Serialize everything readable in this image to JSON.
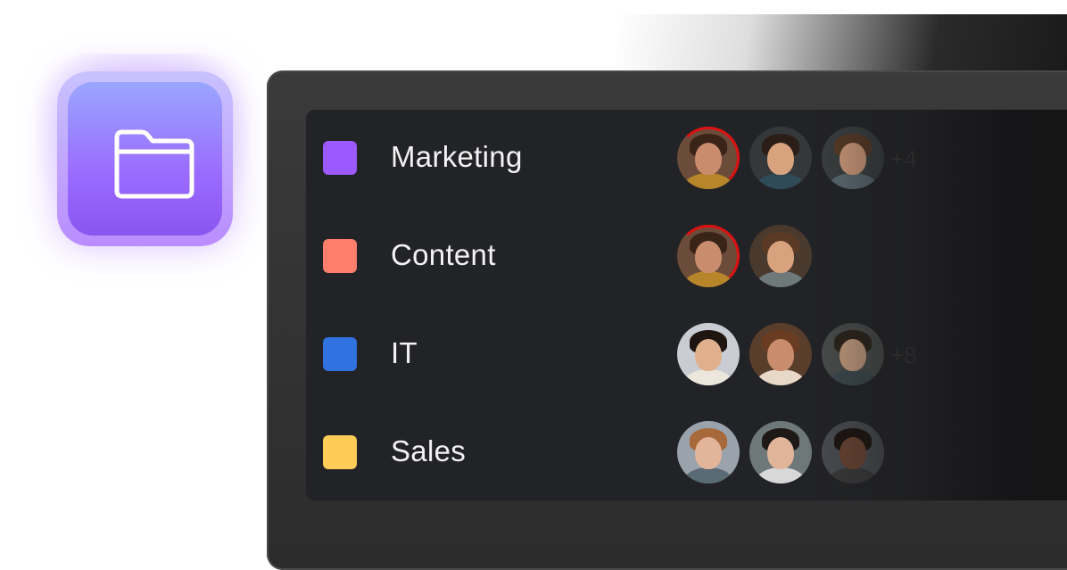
{
  "app_icon": {
    "name": "folder-icon"
  },
  "teams": [
    {
      "name": "Marketing",
      "color": "#9b59ff",
      "more": "+4",
      "avatars": [
        {
          "skin": "#c98d6e",
          "hair": "#3a2418",
          "body": "#b8862a",
          "bg": "#6b4b3a",
          "ring": true
        },
        {
          "skin": "#d9a27f",
          "hair": "#2b1e16",
          "body": "#2f4b57",
          "bg": "#34383b",
          "ring": false
        },
        {
          "skin": "#d8a07e",
          "hair": "#5a3a24",
          "body": "#5d6d74",
          "bg": "#3a3f3f",
          "ring": false
        }
      ]
    },
    {
      "name": "Content",
      "color": "#ff7d6b",
      "more": "",
      "avatars": [
        {
          "skin": "#c98d6e",
          "hair": "#3a2418",
          "body": "#b8862a",
          "bg": "#6b4b3a",
          "ring": true
        },
        {
          "skin": "#d9a27f",
          "hair": "#5a3a24",
          "body": "#6e7a7a",
          "bg": "#4a3a2e",
          "ring": false
        }
      ]
    },
    {
      "name": "IT",
      "color": "#2f72e0",
      "more": "+8",
      "avatars": [
        {
          "skin": "#e0b08c",
          "hair": "#1e1510",
          "body": "#ece6dc",
          "bg": "#c9ccd2",
          "ring": false
        },
        {
          "skin": "#c98d6e",
          "hair": "#6a3c22",
          "body": "#e8d8c8",
          "bg": "#5a3e2c",
          "ring": false
        },
        {
          "skin": "#caa082",
          "hair": "#2b221a",
          "body": "#3c4a4f",
          "bg": "#4a4e4c",
          "ring": false
        }
      ]
    },
    {
      "name": "Sales",
      "color": "#ffcd57",
      "more": "",
      "avatars": [
        {
          "skin": "#e2b59a",
          "hair": "#a7683a",
          "body": "#5a6a75",
          "bg": "#9aa3ab",
          "ring": false
        },
        {
          "skin": "#e0b59a",
          "hair": "#1e1916",
          "body": "#d8d8d8",
          "bg": "#6e7878",
          "ring": false
        },
        {
          "skin": "#6d4532",
          "hair": "#1b120d",
          "body": "#3a3a3a",
          "bg": "#4a4e52",
          "ring": false
        }
      ]
    }
  ]
}
